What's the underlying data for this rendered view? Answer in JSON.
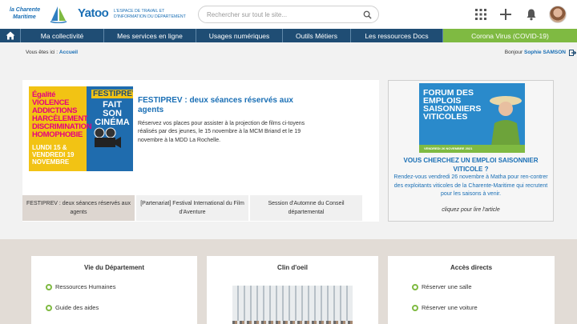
{
  "header": {
    "logo_line1": "la Charente",
    "logo_line2": "Maritime",
    "yatoo": "Yatoo",
    "yatoo_sub": "L'ESPACE DE TRAVAIL ET D'INFORMATION DU DÉPARTEMENT",
    "search_placeholder": "Rechercher sur tout le site...",
    "icons": [
      "apps-grid-icon",
      "plus-icon",
      "bell-icon",
      "avatar"
    ]
  },
  "nav": {
    "items": [
      "Ma collectivité",
      "Mes services en ligne",
      "Usages numériques",
      "Outils Métiers",
      "Les ressources Docs",
      "Corona Virus (COVID-19)"
    ],
    "home_icon": "home-icon",
    "bg_color": "#1f4d74",
    "covid_color": "#7fba42"
  },
  "breadcrumb": {
    "prefix": "Vous êtes ici :",
    "link": "Accueil"
  },
  "user": {
    "greeting": "Bonjour",
    "name": "Sophie SAMSON"
  },
  "news": {
    "image_lines": [
      "Égalité",
      "VIOLENCE",
      "ADDICTIONS",
      "HARCÈLEMENT",
      "DISCRIMINATION",
      "HOMOPHOBIE"
    ],
    "image_title": "FESTIPREV",
    "image_subtitle": "FAIT SON CINÉMA",
    "image_dates": "LUNDI 15 & VENDREDI 19 NOVEMBRE",
    "title": "FESTIPREV : deux séances réservés aux agents",
    "text": "Réservez vos places pour assister à la projection de films ci-toyens réalisés par des jeunes, le 15 novembre à la MCM Briand et le 19 novembre à la MDD La Rochelle.",
    "tabs": [
      "FESTIPREV : deux séances réservés aux agents",
      "[Partenariat] Festival International du Film d'Aventure",
      "Session d'Automne du Conseil départemental"
    ],
    "active_tab": 0
  },
  "promo": {
    "image_title": "FORUM DES EMPLOIS SAISONNIERS VITICOLES",
    "image_date": "VENDREDI 26 NOVEMBRE 2021",
    "title": "VOUS CHERCHEZ UN EMPLOI SAISONNIER VITICOLE ?",
    "text": "Rendez-vous vendredi 26 novembre à Matha pour ren-contrer des exploitants viticoles de la Charente-Maritime qui recrutent pour les saisons à venir.",
    "link": "cliquez pour lire l'article"
  },
  "bottom": {
    "col1": {
      "title": "Vie du Département",
      "links": [
        "Ressources Humaines",
        "Guide des aides"
      ]
    },
    "col2": {
      "title": "Clin d'oeil"
    },
    "col3": {
      "title": "Accès directs",
      "links": [
        "Réserver une salle",
        "Réserver une voiture"
      ]
    }
  }
}
